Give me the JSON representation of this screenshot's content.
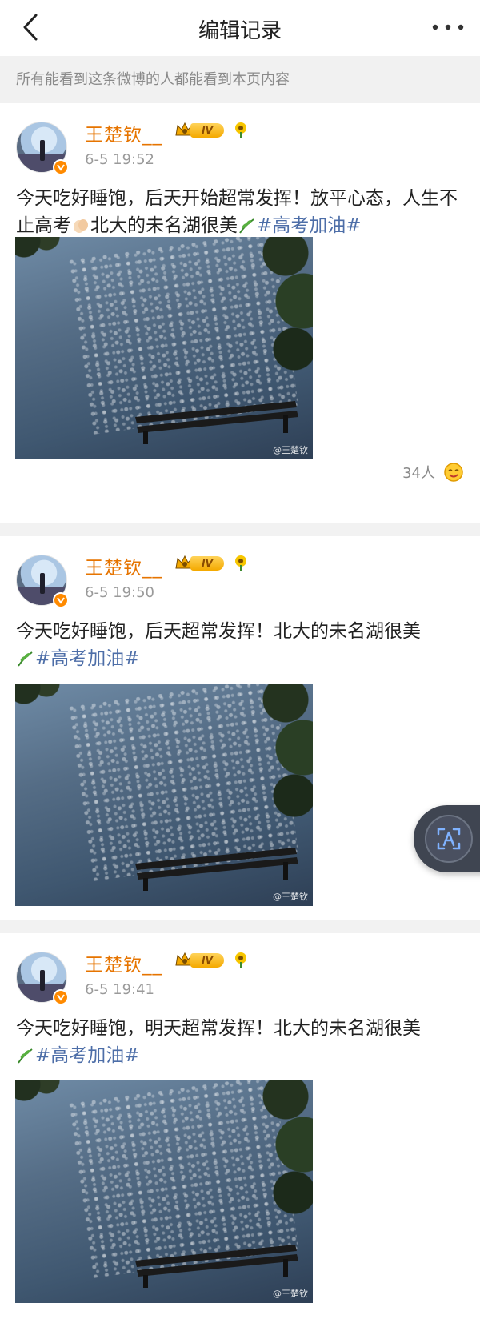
{
  "header": {
    "title": "编辑记录"
  },
  "notice": "所有能看到这条微博的人都能看到本页内容",
  "posts": [
    {
      "username": "王楚钦__",
      "level": "IV",
      "time": "6-5 19:52",
      "text_part1": "今天吃好睡饱，后天开始超常发挥！放平心态，人生不止高考",
      "text_part2": "北大的未名湖很美",
      "hashtag": "#高考加油#",
      "watermark": "@王楚钦",
      "likes": "34人"
    },
    {
      "username": "王楚钦__",
      "level": "IV",
      "time": "6-5 19:50",
      "text": "今天吃好睡饱，后天超常发挥！北大的未名湖很美",
      "hashtag": "#高考加油#",
      "watermark": "@王楚钦"
    },
    {
      "username": "王楚钦__",
      "level": "IV",
      "time": "6-5 19:41",
      "text": "今天吃好睡饱，明天超常发挥！北大的未名湖很美",
      "hashtag": "#高考加油#",
      "watermark": "@王楚钦"
    }
  ],
  "colors": {
    "username": "#e67400",
    "hashtag": "#4d6ea8",
    "muted": "#8a8a8a"
  },
  "icons": {
    "back": "chevron-left-icon",
    "more": "more-dots-icon",
    "verified": "verified-v-icon",
    "crown": "crown-icon",
    "flower": "sunflower-icon",
    "clap": "clapping-hands-icon",
    "herb": "herb-leaf-icon",
    "like": "like-emoji-icon",
    "floating": "text-recognition-icon"
  }
}
